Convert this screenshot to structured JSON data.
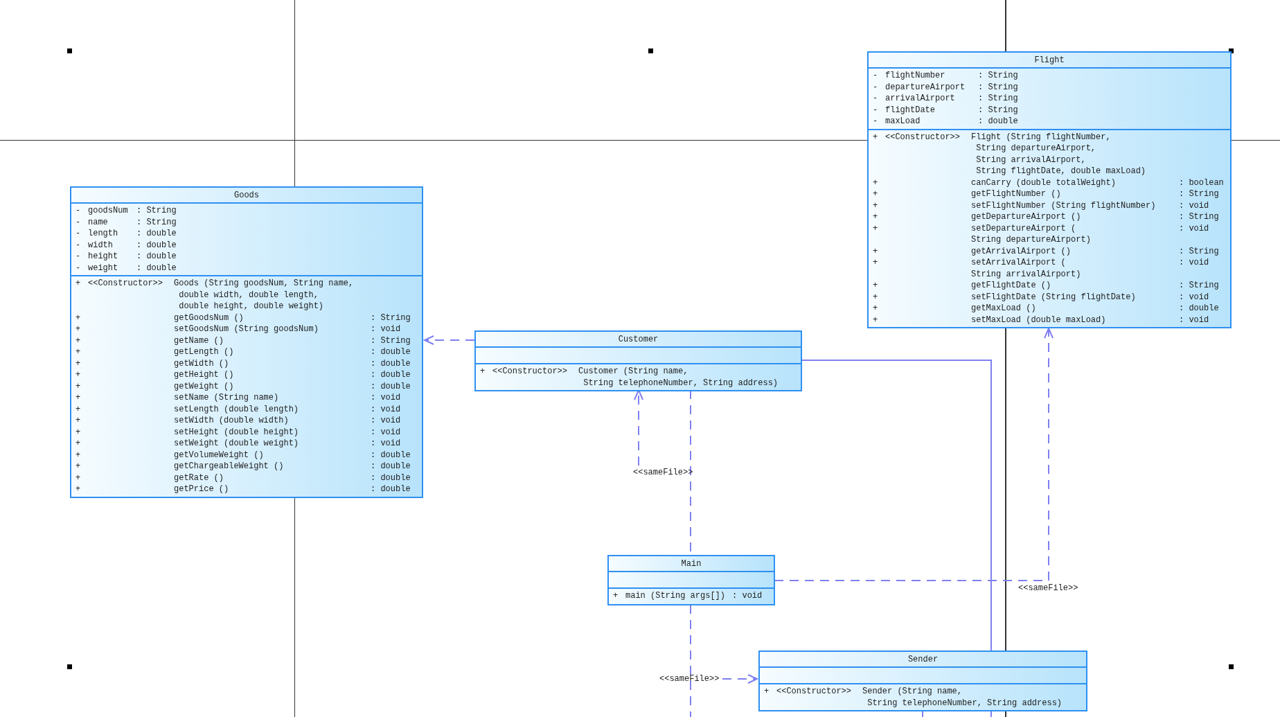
{
  "classes": [
    {
      "name": "Flight",
      "attributes": [
        {
          "visibility": "-",
          "name": "flightNumber",
          "type": ": String"
        },
        {
          "visibility": "-",
          "name": "departureAirport",
          "type": ": String"
        },
        {
          "visibility": "-",
          "name": "arrivalAirport",
          "type": ": String"
        },
        {
          "visibility": "-",
          "name": "flightDate",
          "type": ": String"
        },
        {
          "visibility": "-",
          "name": "maxLoad",
          "type": ": double"
        }
      ],
      "operations": [
        {
          "visibility": "+",
          "stereotype": "<<Constructor>>",
          "signature": "Flight (String flightNumber,\n String departureAirport,\n String arrivalAirport,\n String flightDate, double maxLoad)"
        },
        {
          "visibility": "+",
          "signature": "canCarry (double totalWeight)",
          "type": ": boolean"
        },
        {
          "visibility": "+",
          "signature": "getFlightNumber ()",
          "type": ": String"
        },
        {
          "visibility": "+",
          "signature": "setFlightNumber (String flightNumber)",
          "type": ": void"
        },
        {
          "visibility": "+",
          "signature": "getDepartureAirport ()",
          "type": ": String"
        },
        {
          "visibility": "+",
          "signature": "setDepartureAirport (\nString departureAirport)",
          "type": ": void"
        },
        {
          "visibility": "+",
          "signature": "getArrivalAirport ()",
          "type": ": String"
        },
        {
          "visibility": "+",
          "signature": "setArrivalAirport (\nString arrivalAirport)",
          "type": ": void"
        },
        {
          "visibility": "+",
          "signature": "getFlightDate ()",
          "type": ": String"
        },
        {
          "visibility": "+",
          "signature": "setFlightDate (String flightDate)",
          "type": ": void"
        },
        {
          "visibility": "+",
          "signature": "getMaxLoad ()",
          "type": ": double"
        },
        {
          "visibility": "+",
          "signature": "setMaxLoad (double maxLoad)",
          "type": ": void"
        }
      ]
    },
    {
      "name": "Goods",
      "attributes": [
        {
          "visibility": "-",
          "name": "goodsNum",
          "type": ": String"
        },
        {
          "visibility": "-",
          "name": "name",
          "type": ": String"
        },
        {
          "visibility": "-",
          "name": "length",
          "type": ": double"
        },
        {
          "visibility": "-",
          "name": "width",
          "type": ": double"
        },
        {
          "visibility": "-",
          "name": "height",
          "type": ": double"
        },
        {
          "visibility": "-",
          "name": "weight",
          "type": ": double"
        }
      ],
      "operations": [
        {
          "visibility": "+",
          "stereotype": "<<Constructor>>",
          "signature": "Goods (String goodsNum, String name,\n double width, double length,\n double height, double weight)"
        },
        {
          "visibility": "+",
          "signature": "getGoodsNum ()",
          "type": ": String"
        },
        {
          "visibility": "+",
          "signature": "setGoodsNum (String goodsNum)",
          "type": ": void"
        },
        {
          "visibility": "+",
          "signature": "getName ()",
          "type": ": String"
        },
        {
          "visibility": "+",
          "signature": "getLength ()",
          "type": ": double"
        },
        {
          "visibility": "+",
          "signature": "getWidth ()",
          "type": ": double"
        },
        {
          "visibility": "+",
          "signature": "getHeight ()",
          "type": ": double"
        },
        {
          "visibility": "+",
          "signature": "getWeight ()",
          "type": ": double"
        },
        {
          "visibility": "+",
          "signature": "setName (String name)",
          "type": ": void"
        },
        {
          "visibility": "+",
          "signature": "setLength (double length)",
          "type": ": void"
        },
        {
          "visibility": "+",
          "signature": "setWidth (double width)",
          "type": ": void"
        },
        {
          "visibility": "+",
          "signature": "setHeight (double height)",
          "type": ": void"
        },
        {
          "visibility": "+",
          "signature": "setWeight (double weight)",
          "type": ": void"
        },
        {
          "visibility": "+",
          "signature": "getVolumeWeight ()",
          "type": ": double"
        },
        {
          "visibility": "+",
          "signature": "getChargeableWeight ()",
          "type": ": double"
        },
        {
          "visibility": "+",
          "signature": "getRate ()",
          "type": ": double"
        },
        {
          "visibility": "+",
          "signature": "getPrice ()",
          "type": ": double"
        }
      ]
    },
    {
      "name": "Customer",
      "operations": [
        {
          "visibility": "+",
          "stereotype": "<<Constructor>>",
          "signature": "Customer (String name,\n String telephoneNumber, String address)"
        }
      ]
    },
    {
      "name": "Main",
      "operations": [
        {
          "visibility": "+",
          "signature": "main (String args[])",
          "type": ": void"
        }
      ]
    },
    {
      "name": "Sender",
      "operations": [
        {
          "visibility": "+",
          "stereotype": "<<Constructor>>",
          "signature": "Sender (String name,\n String telephoneNumber, String address)"
        }
      ]
    }
  ],
  "connectors": [
    {
      "label": "<<sameFile>>"
    },
    {
      "label": "<<sameFile>>"
    },
    {
      "label": "<<sameFile>>"
    }
  ]
}
